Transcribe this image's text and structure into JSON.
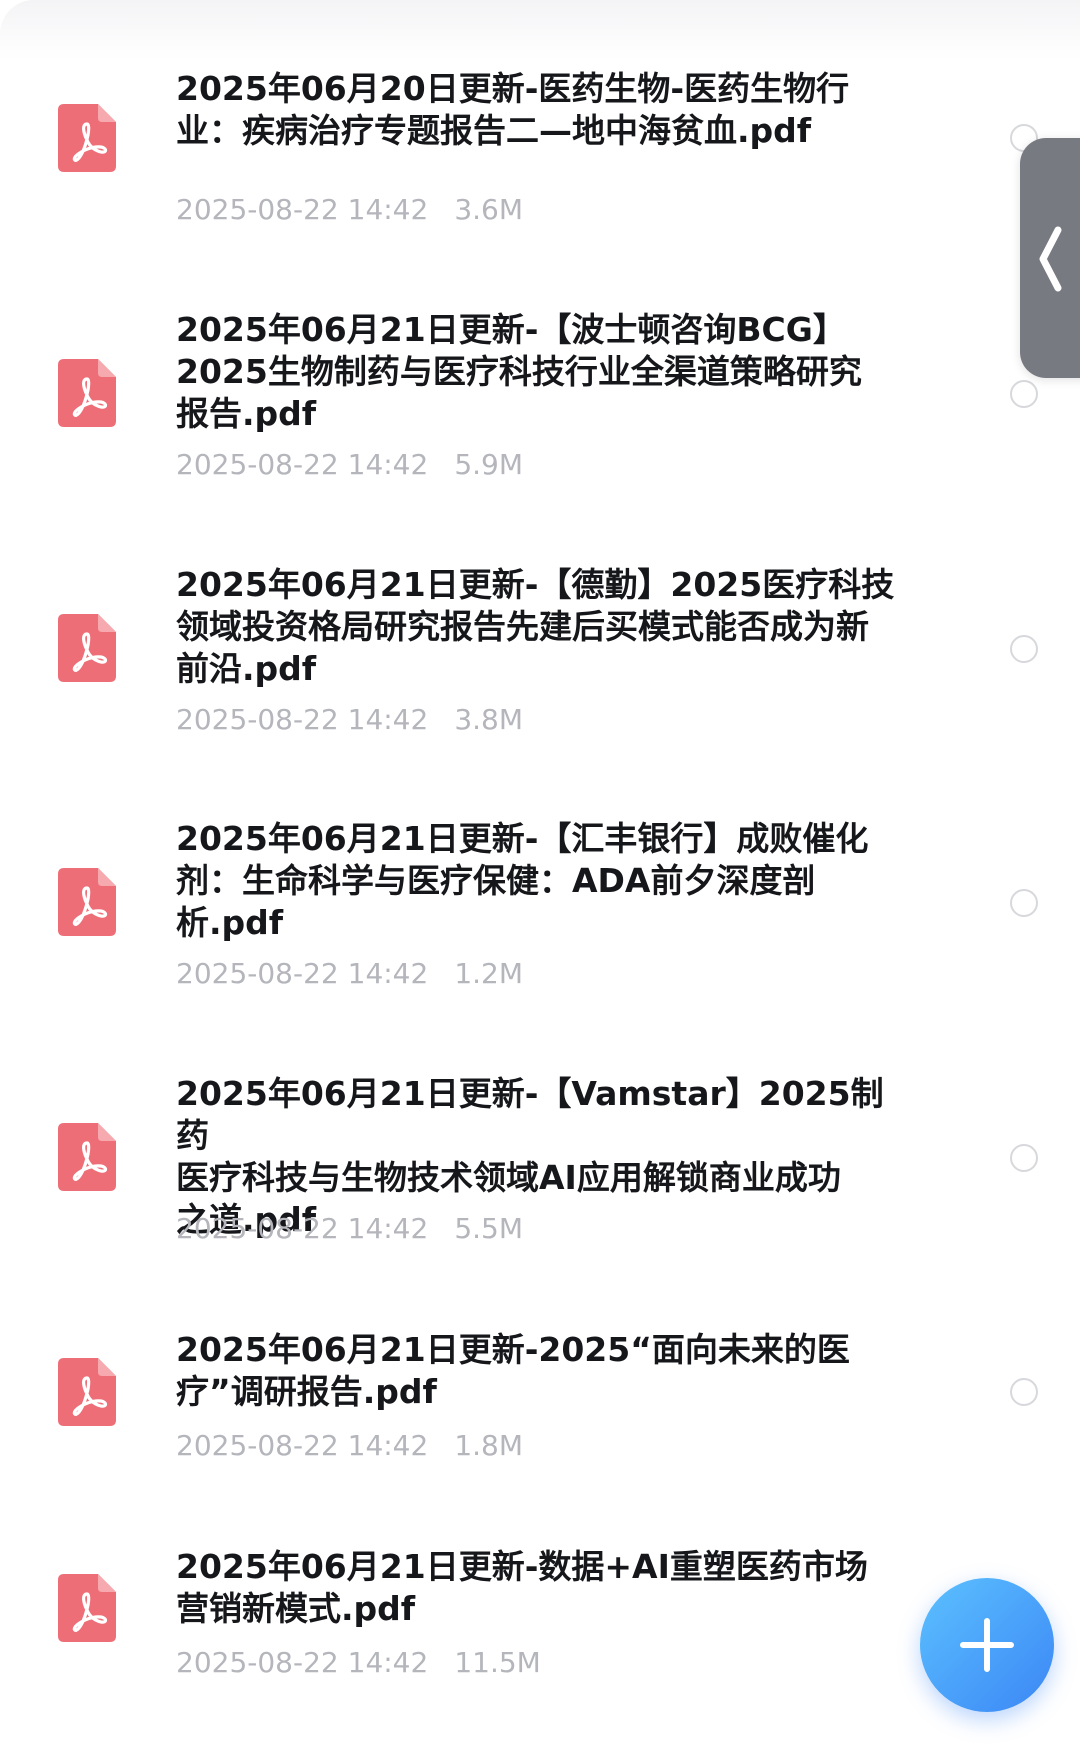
{
  "files": [
    {
      "name_line1": "2025年06月20日更新-医药生物-医药生物行",
      "name_line2": "业：疾病治疗专题报告二—地中海贫血.pdf",
      "name_line3": "",
      "date": "2025-08-22 14:42",
      "size": "3.6M",
      "icon": "pdf-file-icon"
    },
    {
      "name_line1": "2025年06月21日更新-【波士顿咨询BCG】",
      "name_line2": "2025生物制药与医疗科技行业全渠道策略研究",
      "name_line3": "报告.pdf",
      "date": "2025-08-22 14:42",
      "size": "5.9M",
      "icon": "pdf-file-icon"
    },
    {
      "name_line1": "2025年06月21日更新-【德勤】2025医疗科技",
      "name_line2": "领域投资格局研究报告先建后买模式能否成为新",
      "name_line3": "前沿.pdf",
      "date": "2025-08-22 14:42",
      "size": "3.8M",
      "icon": "pdf-file-icon"
    },
    {
      "name_line1": "2025年06月21日更新-【汇丰银行】成败催化",
      "name_line2": "剂：生命科学与医疗保健：ADA前夕深度剖",
      "name_line3": "析.pdf",
      "date": "2025-08-22 14:42",
      "size": "1.2M",
      "icon": "pdf-file-icon"
    },
    {
      "name_line1": "2025年06月21日更新-【Vamstar】2025制药",
      "name_line2": "医疗科技与生物技术领域AI应用解锁商业成功",
      "name_line3": "之道.pdf",
      "date": "2025-08-22 14:42",
      "size": "5.5M",
      "icon": "pdf-file-icon"
    },
    {
      "name_line1": "2025年06月21日更新-2025“面向未来的医",
      "name_line2": "疗”调研报告.pdf",
      "name_line3": "",
      "date": "2025-08-22 14:42",
      "size": "1.8M",
      "icon": "pdf-file-icon"
    },
    {
      "name_line1": "2025年06月21日更新-数据+AI重塑医药市场",
      "name_line2": "营销新模式.pdf",
      "name_line3": "",
      "date": "2025-08-22 14:42",
      "size": "11.5M",
      "icon": "pdf-file-icon"
    }
  ],
  "side_handle": {
    "icon": "chevron-left-icon"
  },
  "fab": {
    "icon": "plus-icon"
  },
  "colors": {
    "pdf_icon": "#ee6e78",
    "title_text": "#16171b",
    "meta_text": "#b4b6bc",
    "radio_border": "#d7d8dc",
    "side_handle": "#777a80",
    "fab_start": "#5cc1ff",
    "fab_end": "#3b86f5"
  }
}
